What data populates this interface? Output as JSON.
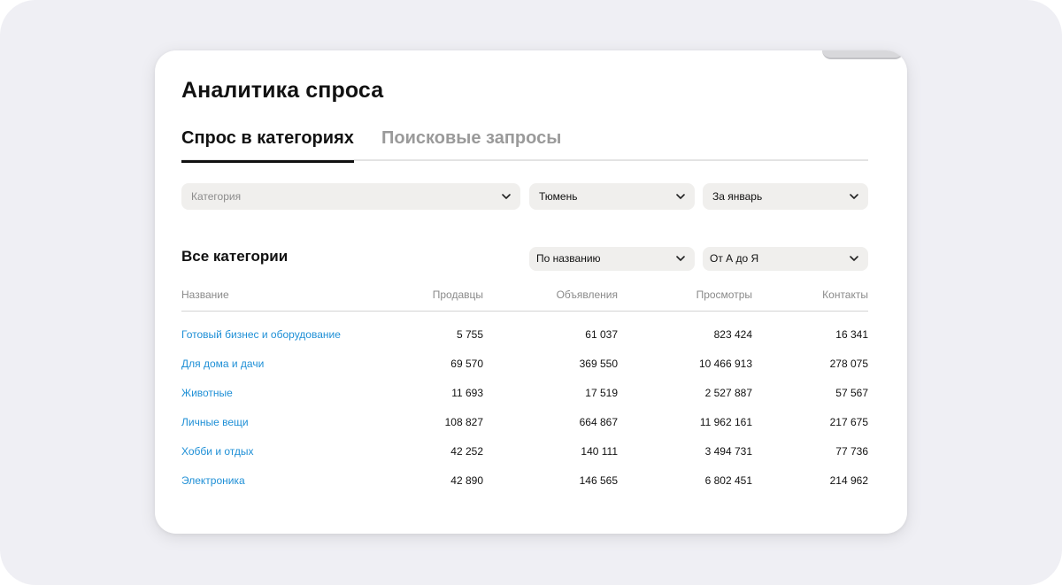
{
  "page_title": "Аналитика спроса",
  "tabs": [
    {
      "label": "Спрос в категориях",
      "active": true
    },
    {
      "label": "Поисковые запросы",
      "active": false
    }
  ],
  "filters": {
    "category": {
      "placeholder": "Категория",
      "value": ""
    },
    "city": {
      "value": "Тюмень"
    },
    "period": {
      "value": "За январь"
    }
  },
  "section_title": "Все категории",
  "sort": {
    "field": "По названию",
    "order": "От А до Я"
  },
  "table": {
    "columns": [
      "Название",
      "Продавцы",
      "Объявления",
      "Просмотры",
      "Контакты"
    ],
    "rows": [
      {
        "name": "Готовый бизнес и оборудование",
        "sellers": "5 755",
        "ads": "61 037",
        "views": "823 424",
        "contacts": "16 341"
      },
      {
        "name": "Для дома и дачи",
        "sellers": "69 570",
        "ads": "369 550",
        "views": "10 466 913",
        "contacts": "278 075"
      },
      {
        "name": "Животные",
        "sellers": "11 693",
        "ads": "17 519",
        "views": "2 527 887",
        "contacts": "57 567"
      },
      {
        "name": "Личные вещи",
        "sellers": "108 827",
        "ads": "664 867",
        "views": "11 962 161",
        "contacts": "217 675"
      },
      {
        "name": "Хобби и отдых",
        "sellers": "42 252",
        "ads": "140 111",
        "views": "3 494 731",
        "contacts": "77 736"
      },
      {
        "name": "Электроника",
        "sellers": "42 890",
        "ads": "146 565",
        "views": "6 802 451",
        "contacts": "214 962"
      }
    ]
  },
  "colors": {
    "link": "#1e8fd6",
    "background": "#efeff4",
    "select_bg": "#f0efed",
    "text": "#111111",
    "muted": "#8a8a8a"
  },
  "icons": {
    "dropdown": "chevron-down-icon"
  }
}
